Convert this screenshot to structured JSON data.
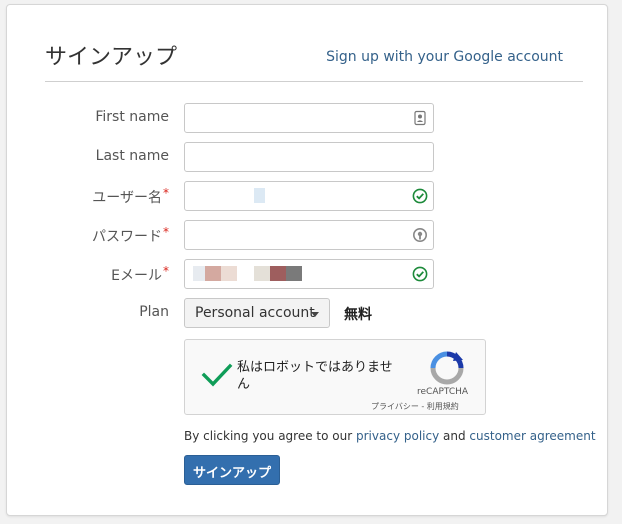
{
  "header": {
    "title": "サインアップ",
    "google_link": "Sign up with your Google account"
  },
  "form": {
    "first_name_label": "First name",
    "last_name_label": "Last name",
    "username_label": "ユーザー名",
    "password_label": "パスワード",
    "email_label": "Eメール",
    "required_mark": "*",
    "plan_label": "Plan",
    "plan_selected": "Personal account",
    "plan_price": "無料"
  },
  "captcha": {
    "text": "私はロボットではありません",
    "brand": "reCAPTCHA",
    "terms": "プライバシー - 利用規約"
  },
  "agreement": {
    "prefix": "By clicking you agree to our",
    "privacy_link": "privacy policy",
    "conjunction": "and",
    "customer_link": "customer agreement"
  },
  "submit_label": "サインアップ",
  "colors": {
    "link": "#34618a",
    "primary_button": "#336fae",
    "required": "#d9251c",
    "valid_check": "#1c8a3a",
    "captcha_check": "#0f9d58"
  },
  "icons": {
    "first_name": "contact-card-icon",
    "username": "valid-check-icon",
    "password": "password-manager-icon",
    "email": "valid-check-icon",
    "captcha": "recaptcha-logo-icon"
  }
}
